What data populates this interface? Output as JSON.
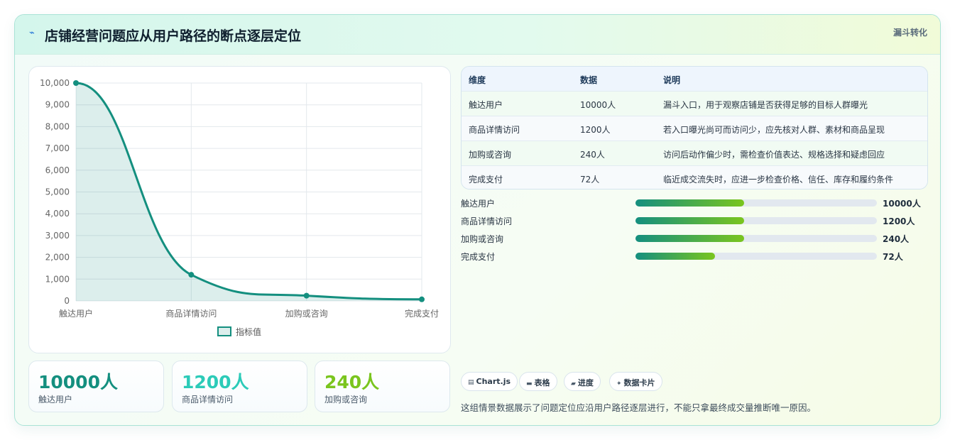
{
  "header": {
    "icon": "sparkle-icon",
    "title": "店铺经营问题应从用户路径的断点逐层定位",
    "badge": "漏斗转化"
  },
  "chart_data": {
    "type": "line",
    "categories": [
      "触达用户",
      "商品详情访问",
      "加购或咨询",
      "完成支付"
    ],
    "series": [
      {
        "name": "指标值",
        "values": [
          10000,
          1200,
          240,
          72
        ]
      }
    ],
    "ylim": [
      0,
      10000
    ],
    "yticks": [
      "0",
      "1,000",
      "2,000",
      "3,000",
      "4,000",
      "5,000",
      "6,000",
      "7,000",
      "8,000",
      "9,000",
      "10,000"
    ],
    "legend_position": "bottom",
    "fill": true,
    "color": "#148f7f",
    "grid": true
  },
  "stats": [
    {
      "value": "10000人",
      "label": "触达用户",
      "color": "#148f7f"
    },
    {
      "value": "1200人",
      "label": "商品详情访问",
      "color": "#2ccbb8"
    },
    {
      "value": "240人",
      "label": "加购或咨询",
      "color": "#7ac51e"
    }
  ],
  "table": {
    "headers": [
      "维度",
      "数据",
      "说明"
    ],
    "rows": [
      [
        "触达用户",
        "10000人",
        "漏斗入口，用于观察店铺是否获得足够的目标人群曝光"
      ],
      [
        "商品详情访问",
        "1200人",
        "若入口曝光尚可而访问少，应先核对人群、素材和商品呈现"
      ],
      [
        "加购或咨询",
        "240人",
        "访问后动作偏少时，需检查价值表达、规格选择和疑虑回应"
      ],
      [
        "完成支付",
        "72人",
        "临近成交流失时，应进一步检查价格、信任、库存和履约条件"
      ]
    ]
  },
  "progress": [
    {
      "label": "触达用户",
      "value": "10000人",
      "fill": 0.45
    },
    {
      "label": "商品详情访问",
      "value": "1200人",
      "fill": 0.45
    },
    {
      "label": "加购或咨询",
      "value": "240人",
      "fill": 0.45
    },
    {
      "label": "完成支付",
      "value": "72人",
      "fill": 0.33
    }
  ],
  "tags": [
    {
      "icon": "chart-icon",
      "glyph": "▤",
      "label": "Chart.js"
    },
    {
      "icon": "table-icon",
      "glyph": "▬",
      "label": "表格"
    },
    {
      "icon": "progress-icon",
      "glyph": "▰",
      "label": "进度"
    },
    {
      "icon": "card-icon",
      "glyph": "✦",
      "label": "数据卡片"
    }
  ],
  "footnote": "这组情景数据展示了问题定位应沿用户路径逐层进行，不能只拿最终成交量推断唯一原因。"
}
